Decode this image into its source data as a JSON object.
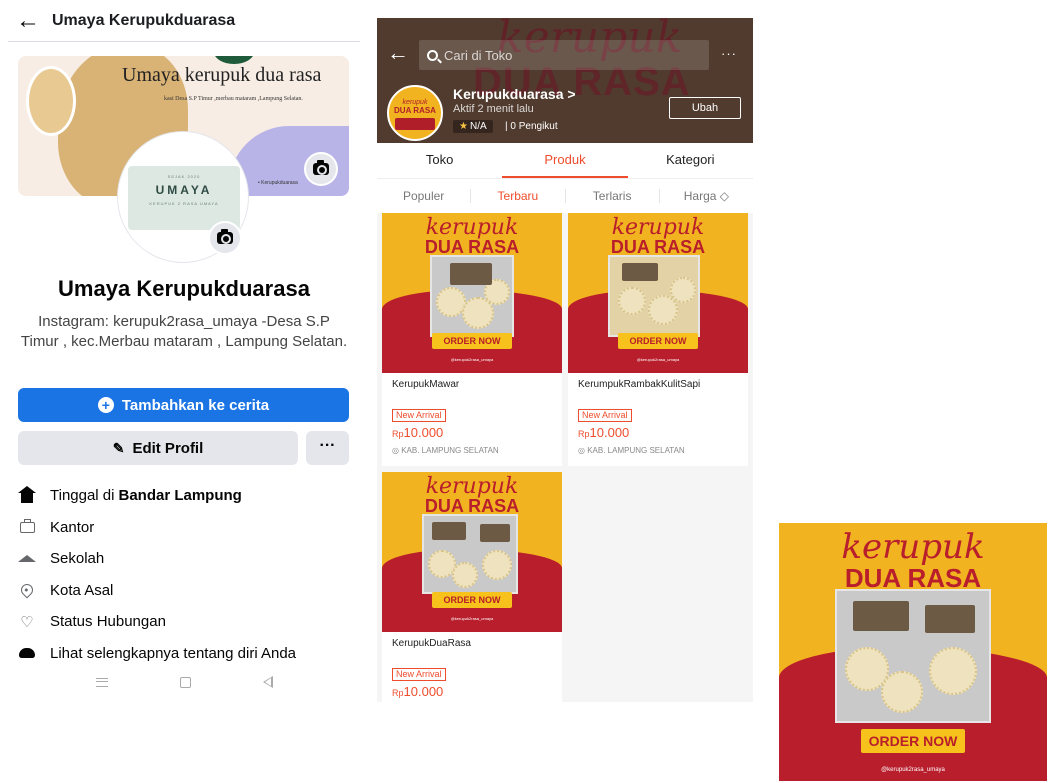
{
  "facebook": {
    "header_title": "Umaya Kerupukduarasa",
    "cover_title": "Umaya kerupuk dua rasa",
    "cover_subtitle": "kasi Desa S.P Timur ,merbau mataram ,Lampung Selatan.",
    "cover_bullet": "• Kerupukduarasa",
    "avatar_top": "SEJAK 2020",
    "avatar_brand": "UMAYA",
    "avatar_tagline": "KERUPUK 2 RASA UMAYA",
    "profile_name": "Umaya Kerupukduarasa",
    "bio": "Instagram: kerupuk2rasa_umaya -Desa S.P Timur , kec.Merbau mataram , Lampung Selatan.",
    "add_story_label": "Tambahkan ke cerita",
    "edit_profile_label": "Edit Profil",
    "more_label": "···",
    "info": {
      "lives_prefix": "Tinggal di",
      "lives_city": "Bandar Lampung",
      "work": "Kantor",
      "school": "Sekolah",
      "hometown": "Kota Asal",
      "relationship": "Status Hubungan",
      "see_more": "Lihat selengkapnya tentang diri Anda"
    }
  },
  "shop": {
    "search_placeholder": "Cari di Toko",
    "more_icon": "···",
    "bg_script": "kerupuk",
    "bg_title": "DUA RASA",
    "logo_script": "kerupuk",
    "logo_title": "DUA RASA",
    "shop_name": "Kerupukduarasa >",
    "active_status": "Aktif 2 menit lalu",
    "rating": "N/A",
    "followers": "| 0 Pengikut",
    "edit_button": "Ubah",
    "tabs": [
      "Toko",
      "Produk",
      "Kategori"
    ],
    "sort_options": [
      "Populer",
      "Terbaru",
      "Terlaris",
      "Harga ◇"
    ],
    "products": [
      {
        "name": "KerupukMawar",
        "badge": "New Arrival",
        "currency": "Rp",
        "price": "10.000",
        "location": "◎ KAB. LAMPUNG SELATAN"
      },
      {
        "name": "KerumpukRambakKulitSapi",
        "badge": "New Arrival",
        "currency": "Rp",
        "price": "10.000",
        "location": "◎ KAB. LAMPUNG SELATAN"
      },
      {
        "name": "KerupukDuaRasa",
        "badge": "New Arrival",
        "currency": "Rp",
        "price": "10.000",
        "location": ""
      }
    ],
    "art": {
      "script": "kerupuk",
      "title": "DUA RASA",
      "cta": "ORDER NOW",
      "handle": "@kerupuk2rasa_umaya"
    }
  },
  "poster": {
    "script": "kerupuk",
    "title": "DUA RASA",
    "cta": "ORDER NOW",
    "handle": "@kerupuk2rasa_umaya"
  },
  "colors": {
    "facebook_blue": "#1b74e4",
    "shop_orange": "#ee4d2d",
    "brand_yellow": "#f2b320",
    "brand_red": "#b81e2b"
  }
}
